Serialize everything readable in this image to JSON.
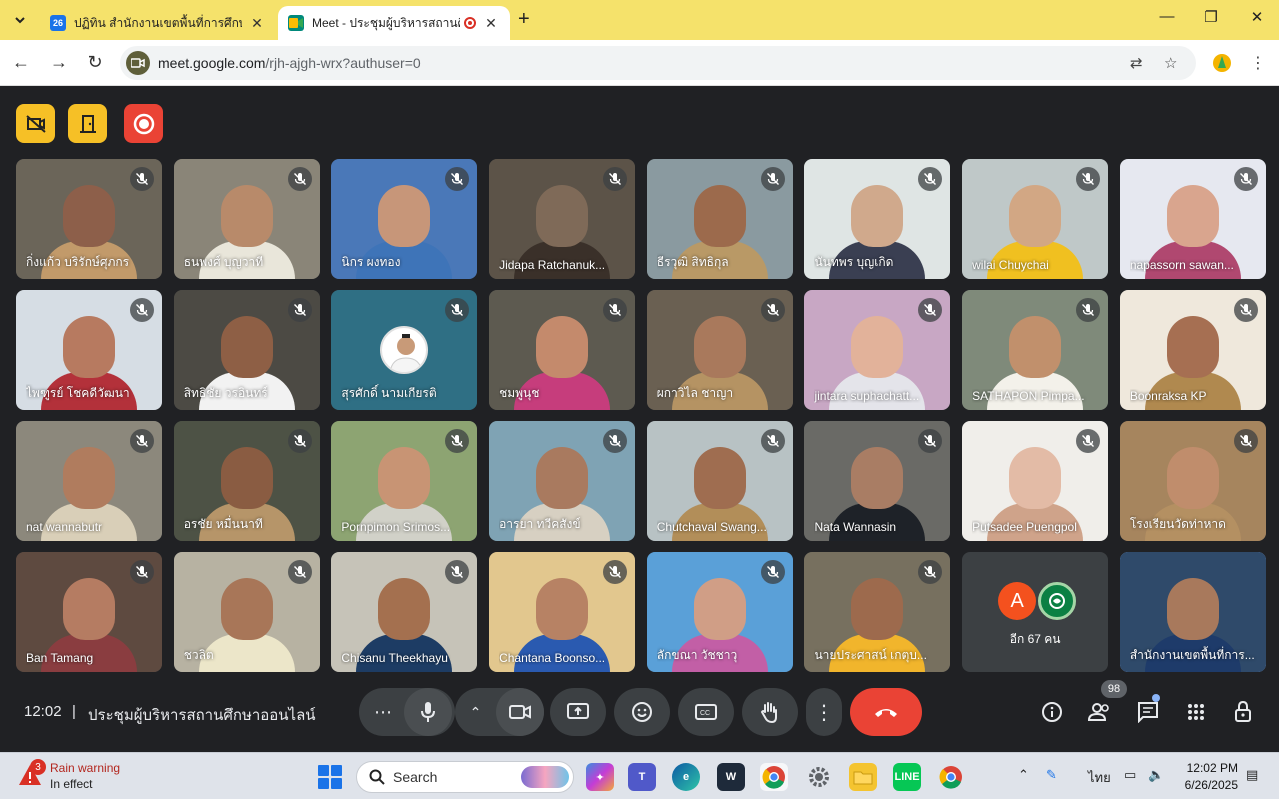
{
  "browser": {
    "tabs": [
      {
        "title": "ปฏิทิน สำนักงานเขตพื้นที่การศึกษาป",
        "favicon_text": "26",
        "favicon_color": "#1a73e8",
        "active": false
      },
      {
        "title": "Meet - ประชุมผู้บริหารสถานศึก",
        "favicon_text": "M",
        "favicon_color": "#00897b",
        "active": true
      }
    ],
    "url_host": "meet.google.com",
    "url_path": "/rjh-ajgh-wrx?authuser=0"
  },
  "meet": {
    "top_buttons": [
      {
        "name": "no-video-filter-button",
        "color": "#f6c026"
      },
      {
        "name": "host-door-button",
        "color": "#f6c026"
      },
      {
        "name": "recording-button",
        "color": "#ea4335"
      }
    ],
    "participants": [
      {
        "name": "กิ่งแก้ว บริรักษ์ศุภกร",
        "bg": "#6b6559",
        "skin": "#8d5f4a",
        "shirt": "#c29a6a"
      },
      {
        "name": "ธนพงศ์ บุญวาที",
        "bg": "#8a8578",
        "skin": "#b88a6a",
        "shirt": "#e9e6da"
      },
      {
        "name": "นิกร ผงทอง",
        "bg": "#4a78b8",
        "skin": "#c79679",
        "shirt": "#3e74b8"
      },
      {
        "name": "Jidapa Ratchanuk...",
        "bg": "#5c5348",
        "skin": "#7f6a58",
        "shirt": "#3a3029"
      },
      {
        "name": "ธีรวุฒิ สิทธิกุล",
        "bg": "#8a9aa0",
        "skin": "#9c6a4c",
        "shirt": "#b99966"
      },
      {
        "name": "นันทพร บุญเกิด",
        "bg": "#dfe5e4",
        "skin": "#d0a98c",
        "shirt": "#3a3f52"
      },
      {
        "name": "wilai Chuychai",
        "bg": "#bfc8c8",
        "skin": "#d2a784",
        "shirt": "#f0c020"
      },
      {
        "name": "napassorn sawan...",
        "bg": "#e6e8f0",
        "skin": "#d9a58e",
        "shirt": "#b04870"
      },
      {
        "name": "ไพฑูรย์ โชคดีวัฒนา",
        "bg": "#d6dde4",
        "skin": "#b77a60",
        "shirt": "#b3313a"
      },
      {
        "name": "สิทธิชัย วรอินทร์",
        "bg": "#4c4a44",
        "skin": "#8e5f45",
        "shirt": "#f2f2f2"
      },
      {
        "name": "สุรศักดิ์ นามเกียรติ",
        "bg": "#2f6f84",
        "skin": "#c89a78",
        "shirt": "#ffffff",
        "avatar": true
      },
      {
        "name": "ชมพูนุช",
        "bg": "#5d5a50",
        "skin": "#c48a6c",
        "shirt": "#c63d7c"
      },
      {
        "name": "ผกาวิไล ชาญา",
        "bg": "#6a6052",
        "skin": "#a9795c",
        "shirt": "#b59363"
      },
      {
        "name": "jintara suphachatt...",
        "bg": "#c8a7c4",
        "skin": "#e2b29a",
        "shirt": "#e4e4ea"
      },
      {
        "name": "SATHAPON Pimpa...",
        "bg": "#7f8a7a",
        "skin": "#c1906c",
        "shirt": "#f3f1ea"
      },
      {
        "name": "Boonraksa KP",
        "bg": "#efe8dc",
        "skin": "#a66f52",
        "shirt": "#b0894f"
      },
      {
        "name": "nat wannabutr",
        "bg": "#8c887c",
        "skin": "#b07c5e",
        "shirt": "#d9cfb8"
      },
      {
        "name": "อรชัย หมื่นนาที",
        "bg": "#4d5245",
        "skin": "#8a5c42",
        "shirt": "#b69569"
      },
      {
        "name": "Pornpimon Srimos...",
        "bg": "#8da472",
        "skin": "#c89474",
        "shirt": "#d1d1c8"
      },
      {
        "name": "อารยา ทวีคสังข์",
        "bg": "#7fa3b4",
        "skin": "#a97a5f",
        "shirt": "#d7d0c2"
      },
      {
        "name": "Chutchaval Swang...",
        "bg": "#b8c2c4",
        "skin": "#9f6d50",
        "shirt": "#b28e59"
      },
      {
        "name": "Nata Wannasin",
        "bg": "#6a6a66",
        "skin": "#a97d64",
        "shirt": "#1e2228"
      },
      {
        "name": "Putsadee Puengpol",
        "bg": "#f0eeea",
        "skin": "#e3bba6",
        "shirt": "#cfa38a"
      },
      {
        "name": "โรงเรียนวัดท่าหาด",
        "bg": "#a6855e",
        "skin": "#c08d6c",
        "shirt": "#b49062"
      },
      {
        "name": "Ban Tamang",
        "bg": "#5e4a40",
        "skin": "#b57c62",
        "shirt": "#8a3d40"
      },
      {
        "name": "ชวลิต",
        "bg": "#b7b2a2",
        "skin": "#a87658",
        "shirt": "#ece6c9"
      },
      {
        "name": "Chisanu Theekhayu",
        "bg": "#c6c3b8",
        "skin": "#a4704f",
        "shirt": "#1d3c64"
      },
      {
        "name": "Chantana Boonso...",
        "bg": "#e2c78e",
        "skin": "#b78264",
        "shirt": "#2a5ab0"
      },
      {
        "name": "ลักขณา วัชชาวุ",
        "bg": "#5aa0d8",
        "skin": "#d09e86",
        "shirt": "#c25fa6"
      },
      {
        "name": "นายประศาสน์ เกตุบ...",
        "bg": "#77705f",
        "skin": "#9d6a4d",
        "shirt": "#f1b52c"
      }
    ],
    "more": {
      "avatar_letter": "A",
      "label": "อีก 67 คน"
    },
    "self_tile": {
      "name": "สำนักงานเขตพื้นที่การ...",
      "bg": "#2f4a6a",
      "skin": "#a8795c",
      "shirt": "#1e3b6a"
    },
    "time": "12:02",
    "separator": "|",
    "title": "ประชุมผู้บริหารสถานศึกษาออนไลน์",
    "participant_count": "98"
  },
  "taskbar": {
    "weather_badge": "3",
    "weather_title": "Rain warning",
    "weather_sub": "In effect",
    "search_label": "Search",
    "lang": "ไทย",
    "time": "12:02 PM",
    "date": "6/26/2025"
  }
}
